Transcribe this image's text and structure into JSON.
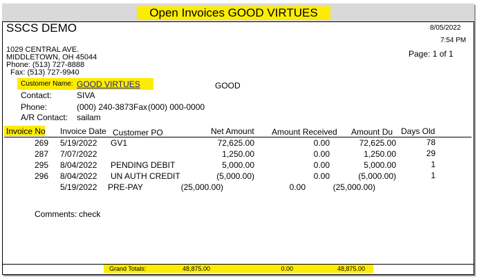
{
  "report": {
    "title": "Open Invoices GOOD VIRTUES",
    "company": "SSCS DEMO",
    "date": "8/05/2022",
    "time": "7:54 PM",
    "page": "Page: 1 of 1",
    "address": {
      "line1": "1029 CENTRAL AVE.",
      "line2": "MIDDLETOWN, OH 45044",
      "phone": "Phone: (513) 727-8888",
      "fax": "Fax: (513) 727-9940"
    }
  },
  "customer": {
    "name_label": "Customer Name:",
    "name": "GOOD VIRTUES",
    "short_name": "GOOD",
    "contact_label": "Contact:",
    "contact": "SIVA",
    "phone_label": "Phone:",
    "phone": "(000) 240-3873",
    "fax_label": "Fax",
    "fax": "(000) 000-0000",
    "ar_label": "A/R Contact:",
    "ar_contact": "sailam"
  },
  "columns": {
    "invoice_no": "Invoice No",
    "invoice_date": "Invoice Date",
    "customer_po": "Customer PO",
    "net_amount": "Net Amount",
    "amount_received": "Amount Received",
    "amount_due": "Amount Du",
    "days_old": "Days Old"
  },
  "rows": [
    {
      "invoice_no": "269",
      "date": "5/19/2022",
      "po": "GV1",
      "net": "72,625.00",
      "received": "0.00",
      "due": "72,625.00",
      "days": "78"
    },
    {
      "invoice_no": "287",
      "date": "7/07/2022",
      "po": "",
      "net": "1,250.00",
      "received": "0.00",
      "due": "1,250.00",
      "days": "29"
    },
    {
      "invoice_no": "295",
      "date": "8/04/2022",
      "po": "PENDING DEBIT",
      "net": "5,000.00",
      "received": "0.00",
      "due": "5,000.00",
      "days": "1"
    },
    {
      "invoice_no": "296",
      "date": "8/04/2022",
      "po": "UN AUTH CREDIT",
      "net": "(5,000.00)",
      "received": "0.00",
      "due": "(5,000.00)",
      "days": "1"
    }
  ],
  "prepay": {
    "date": "5/19/2022",
    "po": "PRE-PAY",
    "net": "(25,000.00)",
    "received": "0.00",
    "due": "(25,000.00)"
  },
  "comments": {
    "label": "Comments:",
    "text": "check"
  },
  "totals": {
    "label": "Grand Totals:",
    "net": "48,875.00",
    "received": "0.00",
    "due": "48,875.00"
  },
  "colors": {
    "highlight": "#fcec03",
    "title_bar": "#d9d9d9",
    "link": "#1a1a8c"
  }
}
